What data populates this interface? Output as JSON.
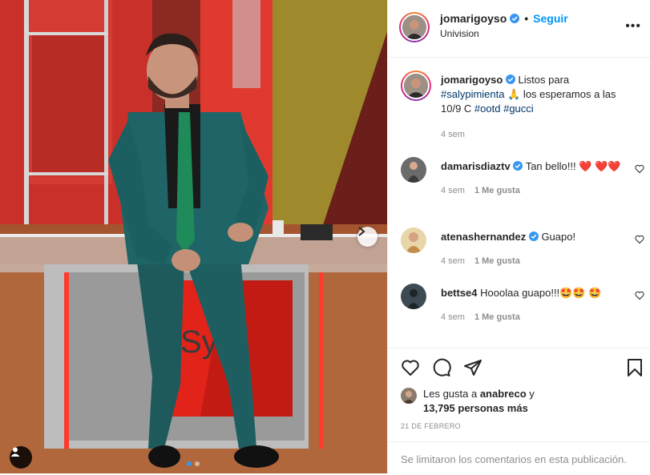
{
  "post": {
    "carousel": {
      "total": 2,
      "active": 0
    },
    "photo_logo_text": "Sy",
    "icons": {
      "next": "chevron-right-icon",
      "tags": "user-tag-icon"
    }
  },
  "header": {
    "username": "jomarigoyso",
    "dot": "•",
    "follow_label": "Seguir",
    "subtitle": "Univision",
    "more_label": "•••"
  },
  "caption": {
    "username": "jomarigoyso",
    "text_1": " Listos para ",
    "hashtag_1": "#salypimienta",
    "emoji_1": "🙏",
    "text_2": " los esperamos a las 10/9 C ",
    "hashtag_2": "#ootd",
    "hashtag_3": "#gucci",
    "time": "4 sem"
  },
  "comments": [
    {
      "username": "damarisdiaztv",
      "text": " Tan bello!!! ❤️ ❤️❤️",
      "time": "4 sem",
      "likes": "1 Me gusta"
    },
    {
      "username": "atenashernandez",
      "text": " Guapo!",
      "time": "4 sem",
      "likes": "1 Me gusta"
    },
    {
      "username": "bettse4",
      "text": " Hooolaa guapo!!!🤩🤩 🤩",
      "time": "4 sem",
      "likes": "1 Me gusta"
    }
  ],
  "likes": {
    "prefix": "Les gusta a ",
    "user": "anabreco",
    "middle": " y ",
    "count": "13,795 personas más"
  },
  "date": "21 DE FEBRERO",
  "comments_disabled": "Se limitaron los comentarios en esta publicación.",
  "colors": {
    "accent": "#0095f6",
    "verified": "#3897f0",
    "hashtag": "#00376b",
    "muted": "#8e8e8e"
  }
}
